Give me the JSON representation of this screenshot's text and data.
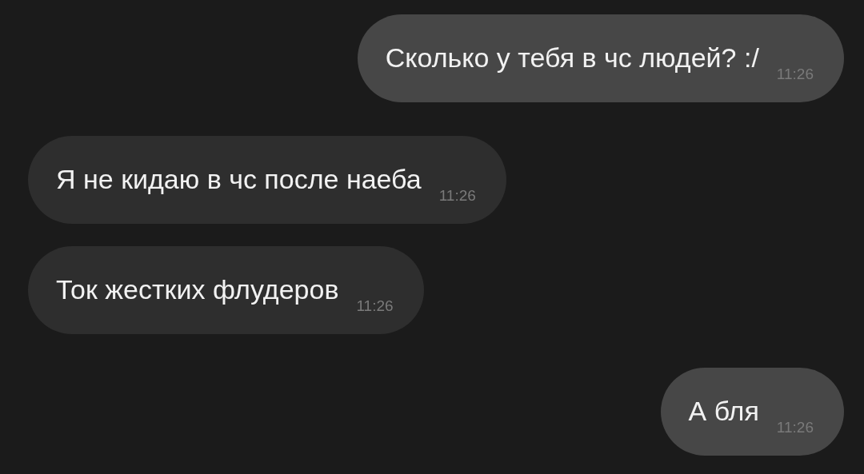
{
  "messages": [
    {
      "kind": "outgoing",
      "text": "Сколько у тебя в чс людей? :/",
      "time": "11:26"
    },
    {
      "kind": "incoming",
      "text": "Я не кидаю в чс после наеба",
      "time": "11:26"
    },
    {
      "kind": "incoming",
      "text": "Ток жестких флудеров",
      "time": "11:26"
    },
    {
      "kind": "outgoing",
      "text": "А бля",
      "time": "11:26"
    }
  ]
}
